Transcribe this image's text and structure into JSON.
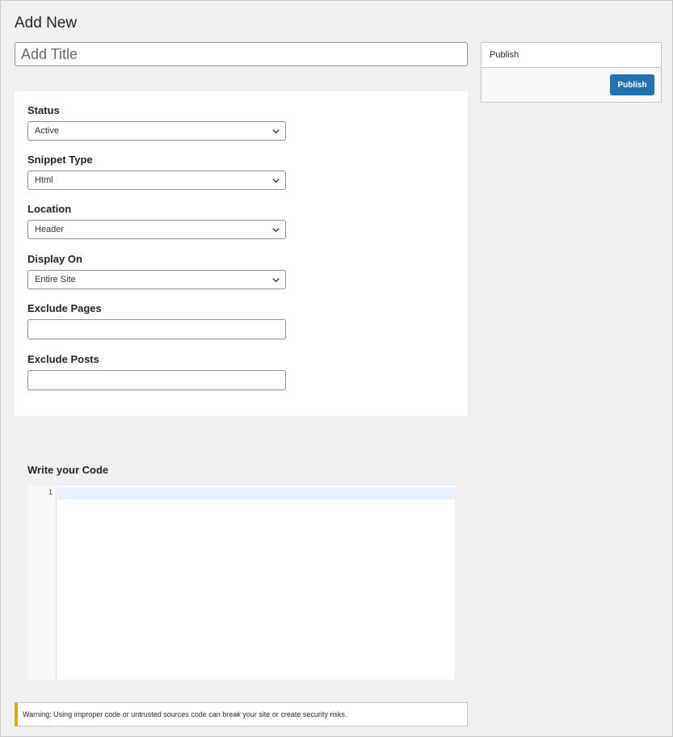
{
  "header": {
    "title": "Add New",
    "title_placeholder": "Add Title"
  },
  "settings": {
    "status": {
      "label": "Status",
      "value": "Active"
    },
    "snippet_type": {
      "label": "Snippet Type",
      "value": "Html"
    },
    "location": {
      "label": "Location",
      "value": "Header"
    },
    "display_on": {
      "label": "Display On",
      "value": "Entire Site"
    },
    "exclude_pages": {
      "label": "Exclude Pages",
      "value": ""
    },
    "exclude_posts": {
      "label": "Exclude Posts",
      "value": ""
    }
  },
  "code": {
    "label": "Write your Code",
    "line_numbers": [
      "1"
    ]
  },
  "warning": {
    "text": "Warning: Using improper code or untrusted sources code can break your site or create security risks."
  },
  "publish": {
    "header": "Publish",
    "button_label": "Publish"
  },
  "icons": {
    "select_arrow": "chevron-down-icon"
  },
  "colors": {
    "primary": "#2271b1",
    "warning_accent": "#dba617",
    "background": "#f0f0f1",
    "active_line": "#e8f2ff"
  }
}
